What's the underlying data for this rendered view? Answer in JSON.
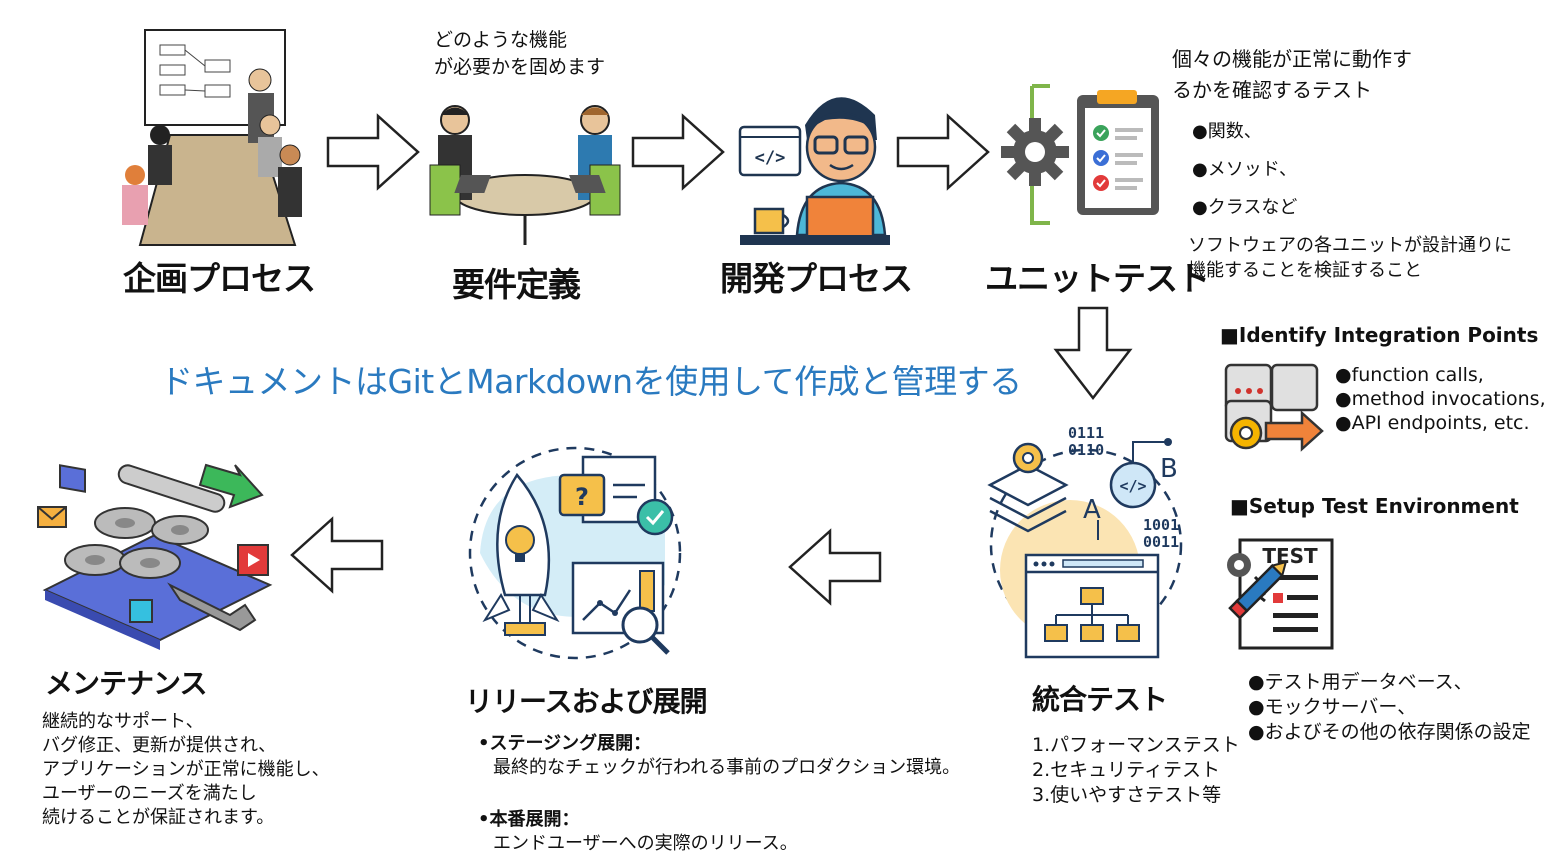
{
  "stages": {
    "planning": {
      "title": "企画プロセス"
    },
    "requirements": {
      "title": "要件定義",
      "caption": [
        "どのような機能",
        "が必要かを固めます"
      ]
    },
    "development": {
      "title": "開発プロセス",
      "icon_code": "</>"
    },
    "unit_test": {
      "title": "ユニットテスト",
      "caption": [
        "個々の機能が正常に動作す",
        "るかを確認するテスト"
      ],
      "bullets": [
        "●関数、",
        "●メソッド、",
        "●クラスなど"
      ],
      "note": [
        "ソフトウェアの各ユニットが設計通りに",
        "機能することを検証すること"
      ]
    },
    "integration_test": {
      "title": "統合テスト",
      "list": [
        "1.パフォーマンステスト",
        "2.セキュリティテスト",
        "3.使いやすさテスト等"
      ],
      "icon_binary_top": [
        "0111",
        "0110"
      ],
      "icon_binary_bottom": [
        "1001",
        "0011"
      ],
      "icon_letter_a": "A",
      "icon_letter_b": "B",
      "icon_code": "</>"
    },
    "release": {
      "title": "リリースおよび展開",
      "staging_label": "•ステージング展開：",
      "staging_desc": "最終的なチェックが行われる事前のプロダクション環境。",
      "production_label": "•本番展開：",
      "production_desc": "エンドユーザーへの実際のリリース。"
    },
    "maintenance": {
      "title": "メンテナンス",
      "desc": [
        "継続的なサポート、",
        "バグ修正、更新が提供され、",
        "アプリケーションが正常に機能し、",
        "ユーザーのニーズを満たし",
        "続けることが保証されます。"
      ]
    }
  },
  "headline": "ドキュメントはGitとMarkdownを使用して作成と管理する",
  "integration_points": {
    "heading": "■Identify Integration Points",
    "items": [
      "●function calls,",
      "●method invocations,",
      "●API endpoints, etc."
    ]
  },
  "test_environment": {
    "heading": "■Setup Test Environment",
    "icon_label": "TEST",
    "items": [
      "●テスト用データベース、",
      "●モックサーバー、",
      "●およびその他の依存関係の設定"
    ]
  },
  "colors": {
    "accent_blue": "#2a7ac0",
    "gear_gray": "#555555",
    "check_green": "#3aa35b",
    "orange": "#f0833a",
    "yellow": "#f5c04a"
  }
}
